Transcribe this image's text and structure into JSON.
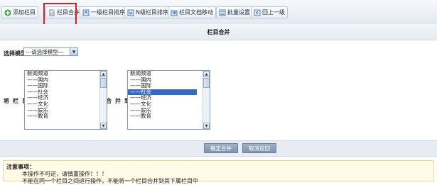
{
  "toolbar": {
    "buttons": [
      {
        "label": "添加栏目",
        "icon": "add-column-icon"
      },
      {
        "label": "栏目合并",
        "icon": "merge-columns-icon"
      },
      {
        "label": "一级栏目排序",
        "icon": "sort-top-level-icon"
      },
      {
        "label": "N级栏目排序",
        "icon": "sort-n-level-icon"
      },
      {
        "label": "栏目文档移动",
        "icon": "move-documents-icon"
      },
      {
        "label": "批量设置",
        "icon": "batch-settings-icon"
      },
      {
        "label": "回上一级",
        "icon": "back-up-icon"
      }
    ]
  },
  "page": {
    "title": "栏目合并"
  },
  "form": {
    "model_label": "选择模型",
    "model_select_value": "---请选择模型---",
    "merge_label": "将栏目",
    "to_label": "合并到"
  },
  "source_list": {
    "options": [
      "新闻频道",
      "——国内",
      "——国际",
      "——社会",
      "——经济",
      "——文化",
      "——娱乐",
      "——教育"
    ],
    "selected_index": -1
  },
  "target_list": {
    "options": [
      "新闻频道",
      "——国内",
      "——国际",
      "——社会",
      "——经济",
      "——文化",
      "——娱乐",
      "——教育"
    ],
    "selected_index": 3
  },
  "actions": {
    "confirm_label": "确定合并",
    "cancel_label": "取消返回"
  },
  "notes": {
    "title": "注意事项：",
    "line1": "本操作不可逆，请慎重操作！！！",
    "line2": "不能在同一个栏目之间进行操作，不能将一个栏目合并到其下属栏目中"
  },
  "colors": {
    "highlight": "#e01c1c",
    "selection": "#316ac5",
    "button": "#8ea3bc"
  }
}
